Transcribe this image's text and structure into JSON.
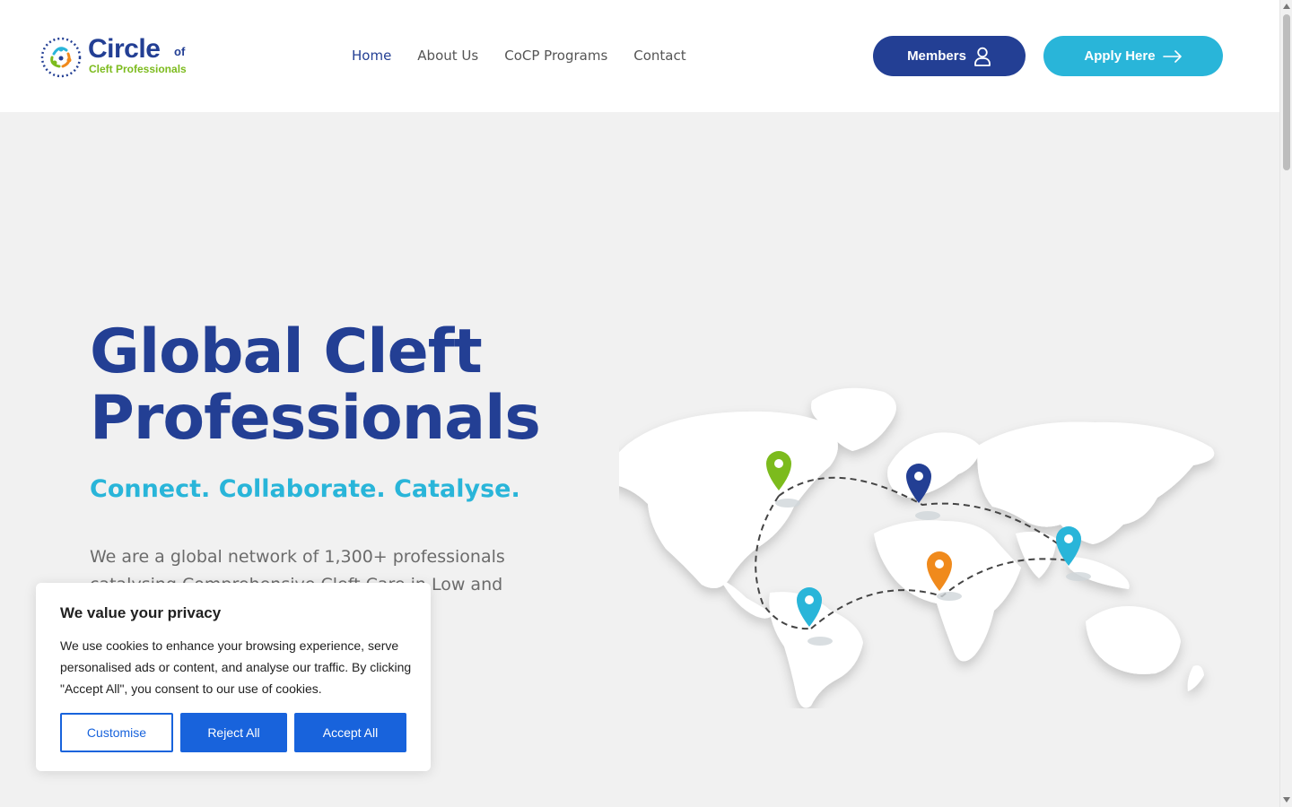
{
  "brand": {
    "name": "Circle",
    "of": "of",
    "sub": "Cleft Professionals",
    "colors": {
      "primary": "#233f94",
      "accent": "#29b5d9",
      "green": "#7cbb1d",
      "orange": "#f08a1c"
    }
  },
  "nav": {
    "items": [
      {
        "label": "Home",
        "active": true
      },
      {
        "label": "About Us",
        "active": false
      },
      {
        "label": "CoCP Programs",
        "active": false
      },
      {
        "label": "Contact",
        "active": false
      }
    ]
  },
  "header": {
    "members_label": "Members",
    "members_icon": "user-icon",
    "apply_label": "Apply Here",
    "apply_icon": "arrow-right-icon"
  },
  "hero": {
    "title": "Global Cleft Professionals",
    "tagline": "Connect. Collaborate. Catalyse.",
    "description": "We are a global network of 1,300+ professionals catalysing Comprehensive Cleft Care in Low and",
    "map_icon": "world-map-illustration"
  },
  "cookie": {
    "title": "We value your privacy",
    "text": "We use cookies to enhance your browsing experience, serve personalised ads or content, and analyse our traffic. By clicking \"Accept All\", you consent to our use of cookies.",
    "customise_label": "Customise",
    "reject_label": "Reject All",
    "accept_label": "Accept All",
    "button_color": "#1863dc"
  }
}
